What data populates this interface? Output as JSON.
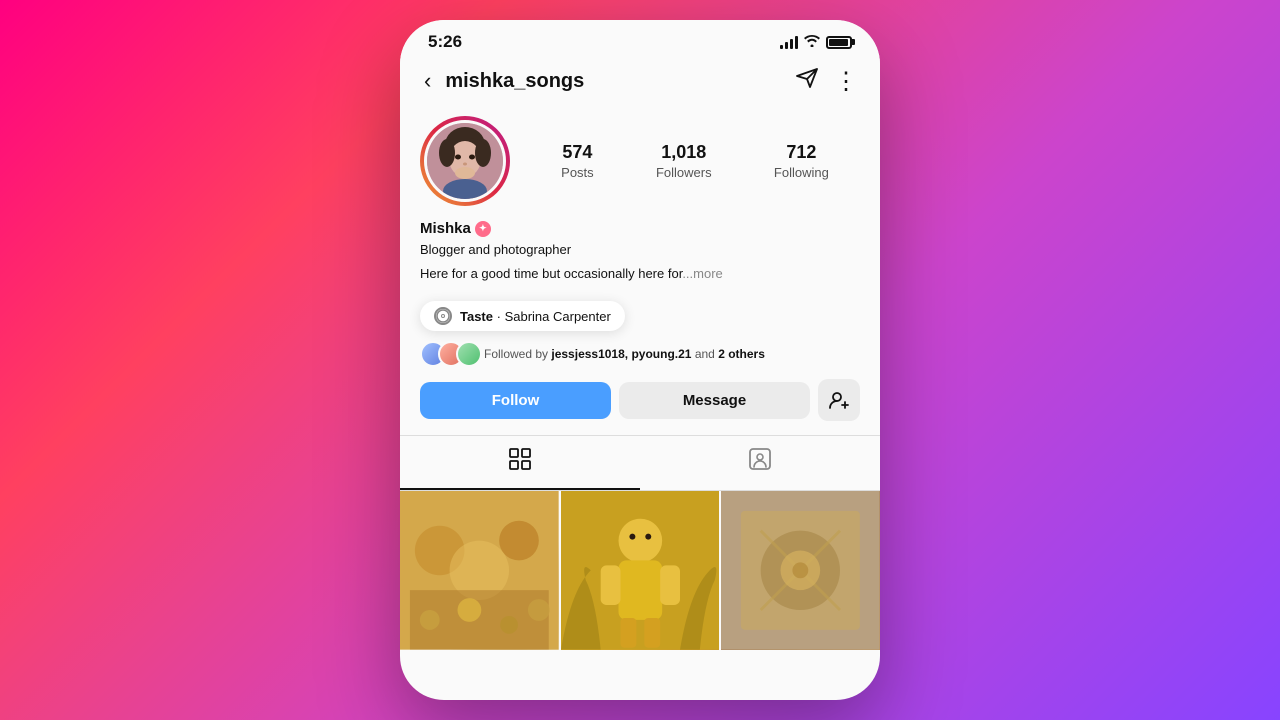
{
  "background": {
    "gradient": "linear-gradient(135deg, #ff0080, #ff4060, #cc44cc, #8844ff)"
  },
  "phone": {
    "status_bar": {
      "time": "5:26"
    },
    "header": {
      "username": "mishka_songs",
      "back_label": "‹",
      "send_icon": "send",
      "more_icon": "more"
    },
    "profile": {
      "display_name": "Mishka",
      "verified": true,
      "bio_line1": "Blogger and photographer",
      "bio_line2": "Here for a good time but occasionally here for",
      "bio_more": "...more",
      "stats": {
        "posts": {
          "number": "574",
          "label": "Posts"
        },
        "followers": {
          "number": "1,018",
          "label": "Followers"
        },
        "following": {
          "number": "712",
          "label": "Following"
        }
      }
    },
    "now_playing": {
      "song": "Taste",
      "artist": "Sabrina Carpenter",
      "separator": "·"
    },
    "mutual_followers": {
      "text_prefix": "Followed by",
      "names": "jessjess1018, pyoung.21",
      "text_suffix": "and",
      "others_count": "2",
      "others_label": "others"
    },
    "action_buttons": {
      "follow": "Follow",
      "message": "Message",
      "add_friend_icon": "person-add"
    },
    "tabs": {
      "grid_icon": "grid",
      "tagged_icon": "person-tag"
    }
  }
}
